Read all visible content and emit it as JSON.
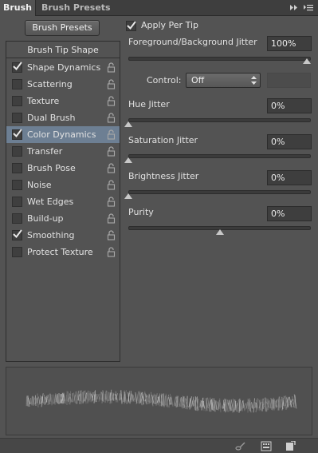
{
  "tabs": [
    {
      "label": "Brush"
    },
    {
      "label": "Brush Presets"
    }
  ],
  "icons": {
    "collapse": "double-chevron-right-icon",
    "menu": "panel-menu-icon",
    "lock": "lock-icon",
    "checkmark": "checkmark-icon",
    "toggle_preview": "brush-pose-toggle-icon",
    "new_preset": "new-brush-preset-icon",
    "grid": "create-new-brush-icon"
  },
  "toolbar": {
    "presets_button": "Brush Presets"
  },
  "left_panel": {
    "header": "Brush Tip Shape",
    "items": [
      {
        "label": "Shape Dynamics",
        "checked": true,
        "selected": false
      },
      {
        "label": "Scattering",
        "checked": false,
        "selected": false
      },
      {
        "label": "Texture",
        "checked": false,
        "selected": false
      },
      {
        "label": "Dual Brush",
        "checked": false,
        "selected": false
      },
      {
        "label": "Color Dynamics",
        "checked": true,
        "selected": true
      },
      {
        "label": "Transfer",
        "checked": false,
        "selected": false
      },
      {
        "label": "Brush Pose",
        "checked": false,
        "selected": false
      },
      {
        "label": "Noise",
        "checked": false,
        "selected": false
      },
      {
        "label": "Wet Edges",
        "checked": false,
        "selected": false
      },
      {
        "label": "Build-up",
        "checked": false,
        "selected": false
      },
      {
        "label": "Smoothing",
        "checked": true,
        "selected": false
      },
      {
        "label": "Protect Texture",
        "checked": false,
        "selected": false
      }
    ]
  },
  "right_panel": {
    "apply_per_tip": {
      "label": "Apply Per Tip",
      "checked": true
    },
    "fg_bg_jitter": {
      "label": "Foreground/Background Jitter",
      "value": "100%",
      "level": 1.0
    },
    "control": {
      "label": "Control:",
      "value": "Off"
    },
    "hue_jitter": {
      "label": "Hue Jitter",
      "value": "0%",
      "level": 0.0
    },
    "saturation_jitter": {
      "label": "Saturation Jitter",
      "value": "0%",
      "level": 0.0
    },
    "brightness_jitter": {
      "label": "Brightness Jitter",
      "value": "0%",
      "level": 0.0
    },
    "purity": {
      "label": "Purity",
      "value": "0%",
      "level": 0.5
    }
  },
  "colors": {
    "panel_bg": "#535353",
    "selected_row": "#6d7f93",
    "field_bg": "#3e3e3e"
  }
}
